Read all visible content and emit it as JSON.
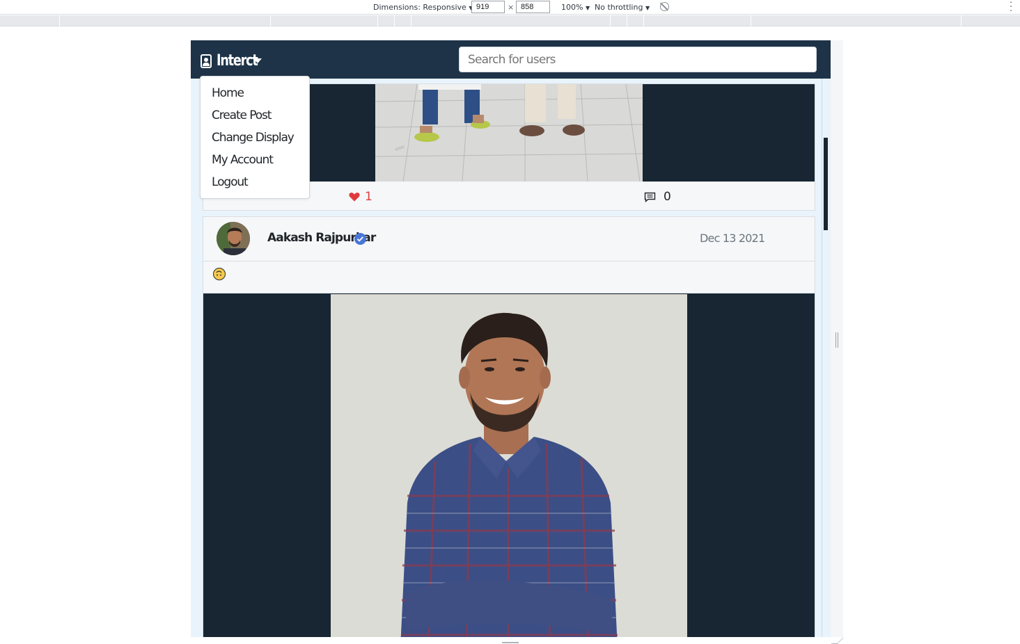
{
  "devtools": {
    "dimensions_label": "Dimensions: Responsive",
    "width_value": "919",
    "height_value": "858",
    "times": "×",
    "zoom": "100%",
    "throttling": "No throttling",
    "dropdown_glyph": "▼"
  },
  "navbar": {
    "brand": "Interct",
    "search_placeholder": "Search for users"
  },
  "menu": {
    "items": [
      "Home",
      "Create Post",
      "Change Display",
      "My Account",
      "Logout"
    ]
  },
  "post1": {
    "likes": "1",
    "comments": "0"
  },
  "post2": {
    "author": "Aakash Rajpurkar",
    "date": "Dec 13 2021"
  },
  "colors": {
    "navbar": "#1e3347",
    "image_backdrop": "#172632",
    "like": "#e03a3e",
    "verified": "#4a76d8"
  }
}
